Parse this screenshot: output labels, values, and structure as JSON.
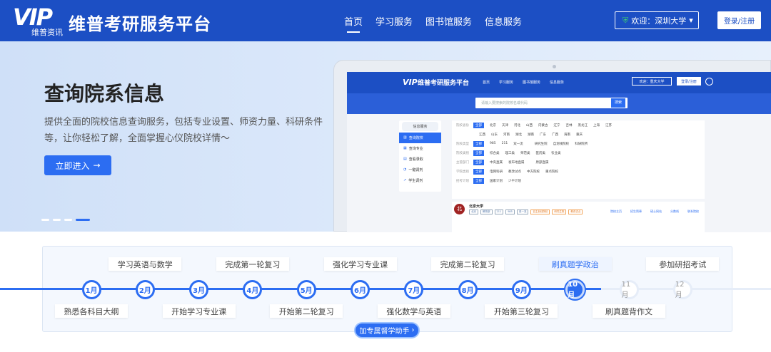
{
  "header": {
    "logo_text": "VIP",
    "logo_sub": "维普资讯",
    "brand": "维普考研服务平台",
    "nav": [
      "首页",
      "学习服务",
      "图书馆服务",
      "信息服务"
    ],
    "welcome": "欢迎：深圳大学",
    "login": "登录/注册"
  },
  "hero": {
    "title": "查询院系信息",
    "desc": "提供全面的院校信息查询服务，包括专业设置、师资力量、科研条件等，让你轻松了解，全面掌握心仪院校详情～",
    "enter_btn": "立即进入"
  },
  "mock": {
    "brand": "维普考研服务平台",
    "nav": [
      "首页",
      "学习服务",
      "图书馆服务",
      "信息服务"
    ],
    "welcome": "欢迎：重庆大学",
    "login": "登录/注册",
    "search_placeholder": "请输入要搜索的院校名或代码",
    "search_btn": "搜索",
    "side_title": "信息服务",
    "side_items": [
      "查询院校",
      "查询专业",
      "查看录取",
      "一键调剂",
      "学生调剂"
    ],
    "filters": [
      {
        "label": "院校省份",
        "items": [
          "全部",
          "北京",
          "天津",
          "河北",
          "山西",
          "内蒙古",
          "辽宁",
          "吉林",
          "黑龙江",
          "上海",
          "江苏"
        ]
      },
      {
        "label": "",
        "items": [
          "",
          "江西",
          "山东",
          "河南",
          "湖北",
          "湖南",
          "广东",
          "广西",
          "海南",
          "重庆"
        ]
      },
      {
        "label": "院校类型",
        "items": [
          "全部",
          "985",
          "211",
          "双一流",
          "",
          "研究生院",
          "自划线院校",
          "科研院所"
        ]
      },
      {
        "label": "院校类别",
        "items": [
          "全部",
          "综合类",
          "理工类",
          "师范类",
          "医药类",
          "农业类"
        ]
      },
      {
        "label": "主管部门",
        "items": [
          "全部",
          "中央直属",
          "发布地直属",
          "",
          "原部直属"
        ]
      },
      {
        "label": "学院类别",
        "items": [
          "全部",
          "电网科研",
          "教改试点",
          "中方院校",
          "重点院校"
        ]
      },
      {
        "label": "招考计划",
        "items": [
          "全部",
          "国家计划",
          "少干计划"
        ]
      }
    ],
    "uni": {
      "name": "北京大学",
      "seal": "北",
      "tags": [
        "北京",
        "教育部",
        "211",
        "985",
        "双一流",
        "自主划线院校",
        "研究生院",
        "教改试点"
      ],
      "links": [
        "院校主页",
        "招生简章",
        "硕士网站",
        "分数线",
        "联系院校"
      ]
    }
  },
  "timeline": {
    "months": [
      "1月",
      "2月",
      "3月",
      "4月",
      "5月",
      "6月",
      "7月",
      "8月",
      "9月",
      "10月",
      "11月",
      "12月"
    ],
    "current_index": 9,
    "above": [
      {
        "text": "学习英语与数学",
        "m": 2
      },
      {
        "text": "完成第一轮复习",
        "m": 4
      },
      {
        "text": "强化学习专业课",
        "m": 6
      },
      {
        "text": "完成第二轮复习",
        "m": 8
      },
      {
        "text": "刷真题学政治",
        "m": 10
      },
      {
        "text": "参加研招考试",
        "m": 12
      }
    ],
    "below": [
      {
        "text": "熟悉各科目大纲",
        "m": 1
      },
      {
        "text": "开始学习专业课",
        "m": 3
      },
      {
        "text": "开始第二轮复习",
        "m": 5
      },
      {
        "text": "强化数学与英语",
        "m": 7
      },
      {
        "text": "开始第三轮复习",
        "m": 9
      },
      {
        "text": "刷真题背作文",
        "m": 11
      }
    ],
    "assist_btn": "加专属督学助手"
  },
  "colors": {
    "brand_blue": "#1c4fc4",
    "accent": "#2c6df2"
  }
}
